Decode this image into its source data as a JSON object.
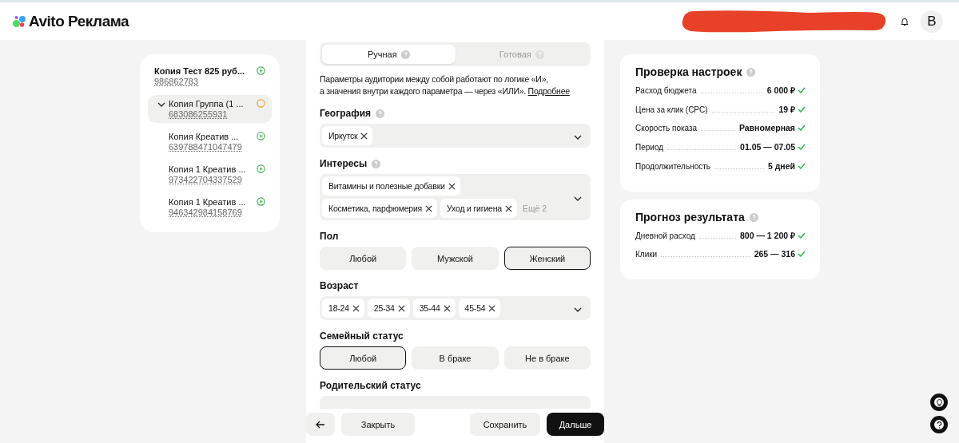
{
  "header": {
    "logo": "Avito Реклама",
    "avatar": "B"
  },
  "tree": {
    "name": "Копия Тест 825 руб...",
    "id": "986862783",
    "running": true,
    "selected": false,
    "children": [
      {
        "name": "Копия Группа (1 ...",
        "id": "683086255931",
        "running": false,
        "selected": true,
        "expanded": true,
        "children": [
          {
            "name": "Копия Креатив ...",
            "id": "639788471047479",
            "running": true,
            "selected": false
          },
          {
            "name": "Копия 1 Креатив ...",
            "id": "973422704337529",
            "running": true,
            "selected": false
          },
          {
            "name": "Копия 1 Креатив ...",
            "id": "946342984158769",
            "running": true,
            "selected": false
          }
        ]
      }
    ]
  },
  "mode_tabs": [
    {
      "label": "Ручная",
      "selected": true
    },
    {
      "label": "Готовая",
      "selected": false
    }
  ],
  "hint": {
    "text": "Параметры аудитории между собой работают по логике «И»,\nа значения внутри каждого параметра — через «ИЛИ».",
    "link": "Подробнее"
  },
  "sections": [
    {
      "kind": "select",
      "title": "География",
      "help": true,
      "chips": [
        "Иркутск"
      ]
    },
    {
      "kind": "select",
      "title": "Интересы",
      "help": true,
      "chips": [
        "Витамины и полезные добавки",
        "Косметика, парфюмерия",
        "Уход и гигиена"
      ],
      "more": "Ещё 2"
    },
    {
      "kind": "segmented",
      "title": "Пол",
      "help": false,
      "options": [
        {
          "label": "Любой",
          "selected": false
        },
        {
          "label": "Мужской",
          "selected": false
        },
        {
          "label": "Женский",
          "selected": true
        }
      ]
    },
    {
      "kind": "select",
      "title": "Возраст",
      "help": false,
      "chips": [
        "18-24",
        "25-34",
        "35-44",
        "45-54"
      ]
    },
    {
      "kind": "segmented",
      "title": "Семейный статус",
      "help": false,
      "options": [
        {
          "label": "Любой",
          "selected": true
        },
        {
          "label": "В браке",
          "selected": false
        },
        {
          "label": "Не в браке",
          "selected": false
        }
      ]
    },
    {
      "kind": "cut",
      "title": "Родительский статус",
      "help": false
    }
  ],
  "footer": {
    "close": "Закрыть",
    "save": "Сохранить",
    "next": "Дальше"
  },
  "cards": [
    {
      "title": "Проверка настроек",
      "rows": [
        {
          "label": "Расход бюджета",
          "value": "6 000 ₽",
          "ok": true
        },
        {
          "label": "Цена за клик (CPC)",
          "value": "19 ₽",
          "ok": true
        },
        {
          "label": "Скорость показа",
          "value": "Равномерная",
          "ok": true
        },
        {
          "label": "Период",
          "value": "01.05 — 07.05",
          "ok": true
        },
        {
          "label": "Продолжительность",
          "value": "5 дней",
          "ok": true
        }
      ]
    },
    {
      "title": "Прогноз результата",
      "rows": [
        {
          "label": "Дневной расход",
          "value": "800 — 1 200 ₽",
          "ok": true
        },
        {
          "label": "Клики",
          "value": "265 — 316",
          "ok": true
        }
      ]
    }
  ]
}
